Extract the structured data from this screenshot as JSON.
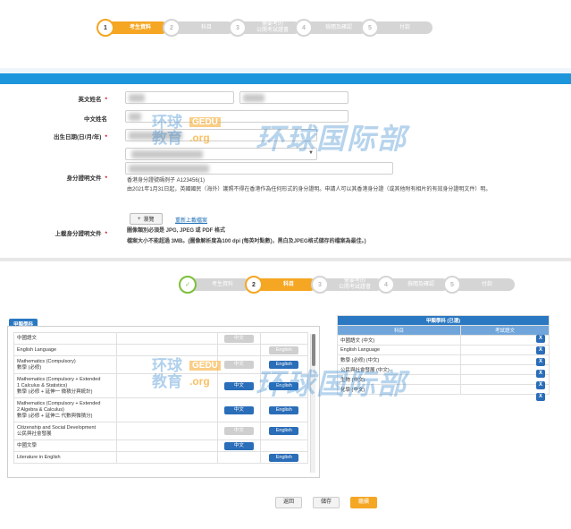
{
  "stepper_top": {
    "steps": [
      {
        "num": "1",
        "label": "考生資料",
        "state": "active"
      },
      {
        "num": "2",
        "label": "科目",
        "state": "pending"
      },
      {
        "num": "3",
        "label": "需要考的\n公開考試證書",
        "state": "pending"
      },
      {
        "num": "4",
        "label": "檢閱及確認",
        "state": "pending"
      },
      {
        "num": "5",
        "label": "付款",
        "state": "pending"
      }
    ]
  },
  "form": {
    "english_name_label": "英文姓名",
    "chinese_name_label": "中文姓名",
    "dob_label": "出生日期(日/月/年)",
    "id_doc_label": "身分證明文件",
    "id_hint_1": "香港身分證號碼例子 A123456(1)",
    "id_hint_2": "由2021年1月31日起，英國國民（海外）護照不得在香港作為任何形式的身分證明。申請人可以其香港身分證（或其他附有相片的有效身分證明文件）明。",
    "browse_label": "瀏覽",
    "reupload_link": "重新上載檔案",
    "upload_label": "上載身分證明文件",
    "upload_hint_1": "圖像類別必須是 JPG, JPEG 或 PDF 格式",
    "upload_hint_2": "檔案大小不能超過 3MB。(圖像解析度為100 dpi (每英吋點數)，黑白及JPEG格式儲存的檔案為最佳。)",
    "required_mark": "*"
  },
  "watermark": {
    "line1": "环球",
    "line2": "教育",
    "tag": "GEDU",
    "org": ".org",
    "big": "环球国际部"
  },
  "stepper_bottom": {
    "steps": [
      {
        "num": "✓",
        "label": "考生資料",
        "state": "done"
      },
      {
        "num": "2",
        "label": "科目",
        "state": "active"
      },
      {
        "num": "3",
        "label": "需要考的\n公開考試證書",
        "state": "pending"
      },
      {
        "num": "4",
        "label": "檢閱及確認",
        "state": "pending"
      },
      {
        "num": "5",
        "label": "付款",
        "state": "pending"
      }
    ]
  },
  "subjects": {
    "tab_label": "甲類學科",
    "rows": [
      {
        "name": "中國語文",
        "btn1": "中文",
        "btn1_on": false,
        "btn2": "",
        "btn2_on": false
      },
      {
        "name": "English Language",
        "btn1": "",
        "btn1_on": false,
        "btn2": "English",
        "btn2_on": false
      },
      {
        "name": "Mathematics (Compulsory)\n數學 (必修)",
        "btn1": "中文",
        "btn1_on": false,
        "btn2": "English",
        "btn2_on": true
      },
      {
        "name": "Mathematics (Compulsory + Extended\n1 Calculus & Statistics)\n數學 (必修 + 延伸一 微積分與統計)",
        "btn1": "中文",
        "btn1_on": true,
        "btn2": "English",
        "btn2_on": true
      },
      {
        "name": "Mathematics (Compulsory + Extended\n2 Algebra & Calculus)\n數學 (必修 + 延伸二 代數與微積分)",
        "btn1": "中文",
        "btn1_on": true,
        "btn2": "English",
        "btn2_on": true
      },
      {
        "name": "Citizenship and Social Development\n公民與社會發展",
        "btn1": "中文",
        "btn1_on": false,
        "btn2": "English",
        "btn2_on": true
      },
      {
        "name": "中國文學",
        "btn1": "中文",
        "btn1_on": true,
        "btn2": "",
        "btn2_on": false
      },
      {
        "name": "Literature in English",
        "btn1": "",
        "btn1_on": false,
        "btn2": "English",
        "btn2_on": true
      }
    ]
  },
  "chosen": {
    "title": "甲類學科 (已選)",
    "col_subject": "科目",
    "col_remark": "考試語文",
    "rows": [
      {
        "name": "中國語文 (中文)"
      },
      {
        "name": "English Language"
      },
      {
        "name": "數學 (必修) (中文)"
      },
      {
        "name": "公民與社會發展 (中文)"
      },
      {
        "name": "生物 (中文)"
      },
      {
        "name": "化學 (中文)"
      }
    ],
    "remove_label": "X"
  },
  "actions": {
    "back": "返回",
    "save": "儲存",
    "submit": "繼續"
  },
  "colors": {
    "accent": "#f5a623",
    "primary": "#2a78c2",
    "band": "#1e96dc",
    "done": "#7cbf3a"
  }
}
